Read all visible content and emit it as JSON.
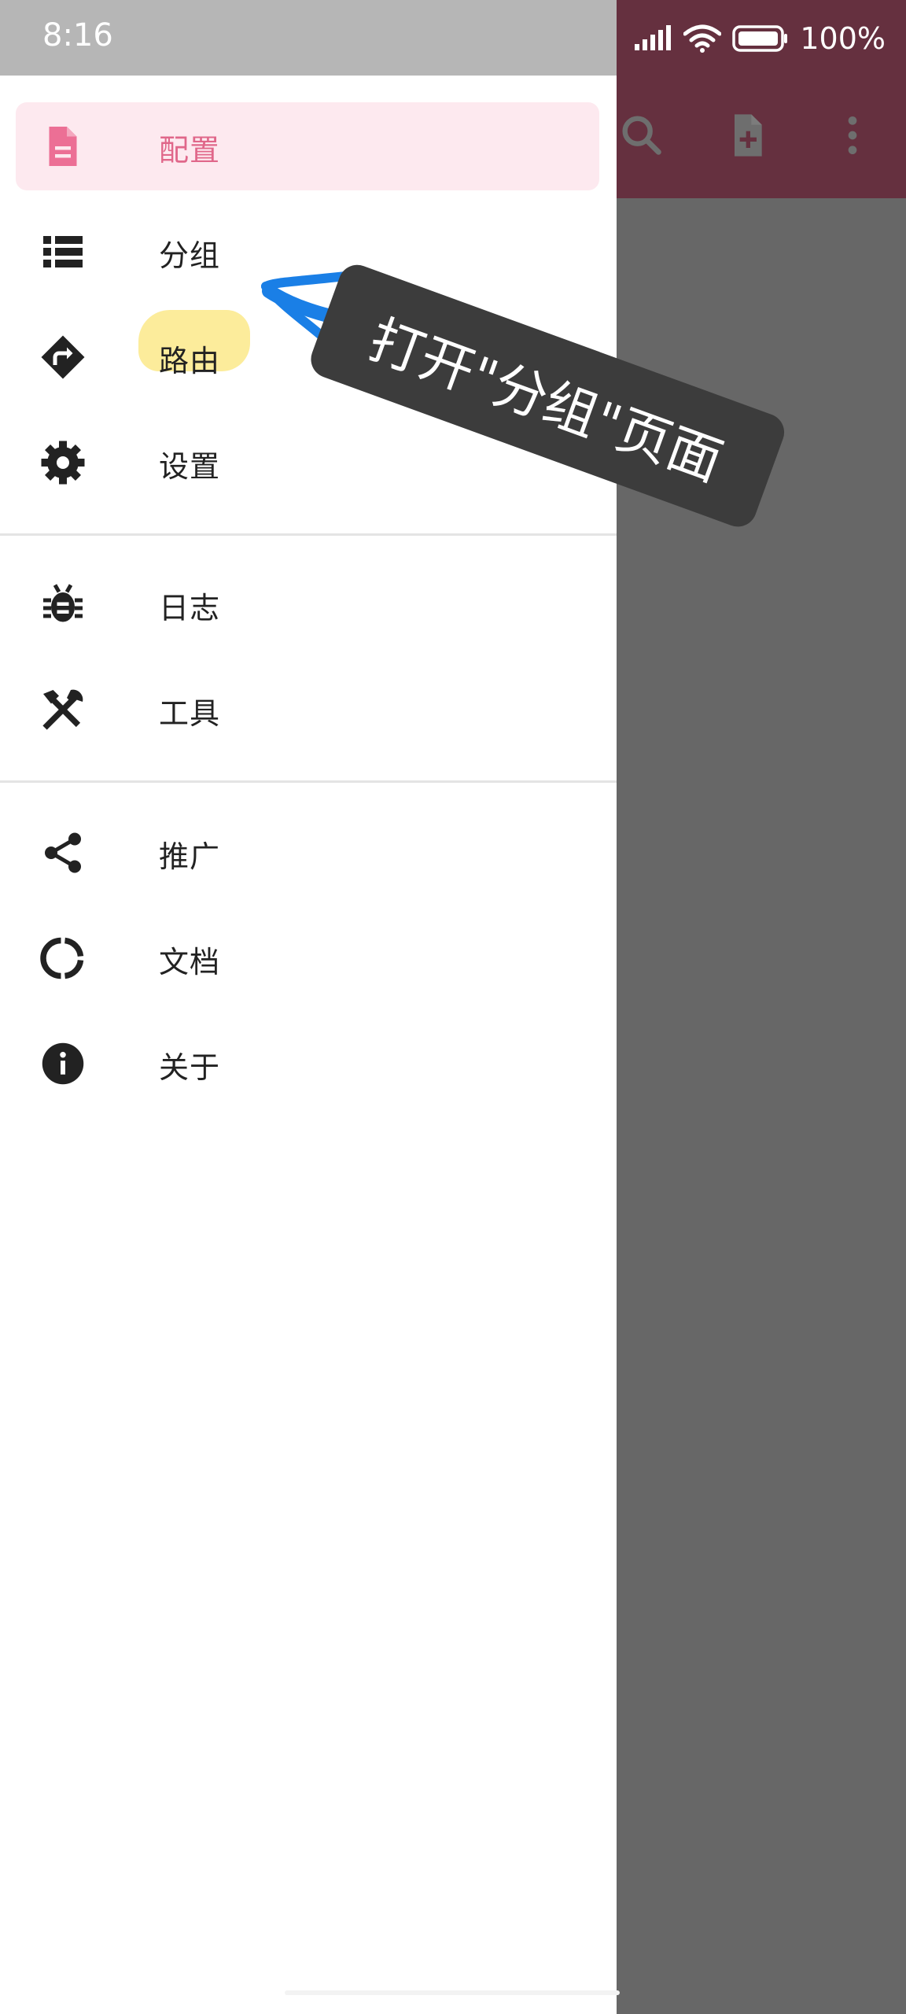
{
  "status_bar": {
    "time": "8:16",
    "battery": "100%"
  },
  "drawer": {
    "items": [
      {
        "label": "配置",
        "icon": "file-icon",
        "active": true
      },
      {
        "label": "分组",
        "icon": "list-icon"
      },
      {
        "label": "路由",
        "icon": "route-icon"
      },
      {
        "label": "设置",
        "icon": "gear-icon"
      },
      {
        "label": "日志",
        "icon": "bug-icon"
      },
      {
        "label": "工具",
        "icon": "tools-icon"
      },
      {
        "label": "推广",
        "icon": "share-icon"
      },
      {
        "label": "文档",
        "icon": "docs-ring-icon"
      },
      {
        "label": "关于",
        "icon": "info-icon"
      }
    ]
  },
  "annotation": {
    "text": "打开\"分组\"页面"
  },
  "colors": {
    "toolbar": "#65303f",
    "active_bg": "#fde9ef",
    "active_fg": "#e0678a",
    "arrow": "#1a7fe6",
    "highlight": "#fbe98a"
  }
}
